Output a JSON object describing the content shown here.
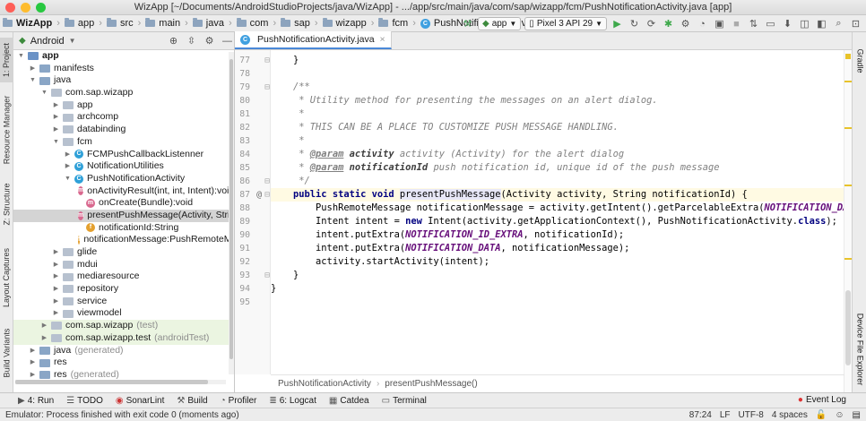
{
  "titlebar": {
    "title": "WizApp [~/Documents/AndroidStudioProjects/java/WizApp] - .../app/src/main/java/com/sap/wizapp/fcm/PushNotificationActivity.java [app]"
  },
  "navbar": {
    "crumbs": [
      "WizApp",
      "app",
      "src",
      "main",
      "java",
      "com",
      "sap",
      "wizapp",
      "fcm",
      "PushNotificationActivity"
    ],
    "run_config": "app",
    "device": "Pixel 3 API 29"
  },
  "left_strip": {
    "tabs": [
      "1: Project",
      "Resource Manager",
      "Z: Structure",
      "Layout Captures",
      "Build Variants"
    ]
  },
  "right_strip": {
    "tabs": [
      "Gradle",
      "Device File Explorer"
    ]
  },
  "project": {
    "view_label": "Android",
    "tree": [
      {
        "label": "app",
        "indent": 0,
        "icon": "module-folder-icon",
        "arrow": "down"
      },
      {
        "label": "manifests",
        "indent": 1,
        "icon": "folder-icon",
        "arrow": "right"
      },
      {
        "label": "java",
        "indent": 1,
        "icon": "folder-icon",
        "arrow": "down"
      },
      {
        "label": "com.sap.wizapp",
        "indent": 2,
        "icon": "package-icon",
        "arrow": "down"
      },
      {
        "label": "app",
        "indent": 3,
        "icon": "package-icon",
        "arrow": "right"
      },
      {
        "label": "archcomp",
        "indent": 3,
        "icon": "package-icon",
        "arrow": "right"
      },
      {
        "label": "databinding",
        "indent": 3,
        "icon": "package-icon",
        "arrow": "right"
      },
      {
        "label": "fcm",
        "indent": 3,
        "icon": "package-icon",
        "arrow": "down"
      },
      {
        "label": "FCMPushCallbackListenner",
        "indent": 4,
        "icon": "class",
        "arrow": "right"
      },
      {
        "label": "NotificationUtilities",
        "indent": 4,
        "icon": "class",
        "arrow": "right"
      },
      {
        "label": "PushNotificationActivity",
        "indent": 4,
        "icon": "class",
        "arrow": "down"
      },
      {
        "label": "onActivityResult(int, int, Intent):void",
        "indent": 5,
        "icon": "method",
        "arrow": ""
      },
      {
        "label": "onCreate(Bundle):void",
        "indent": 5,
        "icon": "method",
        "arrow": ""
      },
      {
        "label": "presentPushMessage(Activity, String):void",
        "indent": 5,
        "icon": "method",
        "arrow": "",
        "selected": true
      },
      {
        "label": "notificationId:String",
        "indent": 5,
        "icon": "field",
        "arrow": ""
      },
      {
        "label": "notificationMessage:PushRemoteMessage",
        "indent": 5,
        "icon": "field",
        "arrow": ""
      },
      {
        "label": "glide",
        "indent": 3,
        "icon": "package-icon",
        "arrow": "right"
      },
      {
        "label": "mdui",
        "indent": 3,
        "icon": "package-icon",
        "arrow": "right"
      },
      {
        "label": "mediaresource",
        "indent": 3,
        "icon": "package-icon",
        "arrow": "right"
      },
      {
        "label": "repository",
        "indent": 3,
        "icon": "package-icon",
        "arrow": "right"
      },
      {
        "label": "service",
        "indent": 3,
        "icon": "package-icon",
        "arrow": "right"
      },
      {
        "label": "viewmodel",
        "indent": 3,
        "icon": "package-icon",
        "arrow": "right"
      },
      {
        "label": "com.sap.wizapp",
        "suffix": "(test)",
        "indent": 2,
        "icon": "package-icon",
        "arrow": "right",
        "generated": true
      },
      {
        "label": "com.sap.wizapp.test",
        "suffix": "(androidTest)",
        "indent": 2,
        "icon": "package-icon",
        "arrow": "right",
        "generated": true
      },
      {
        "label": "java",
        "suffix": "(generated)",
        "indent": 1,
        "icon": "folder-icon",
        "arrow": "right"
      },
      {
        "label": "res",
        "indent": 1,
        "icon": "folder-icon",
        "arrow": "right"
      },
      {
        "label": "res",
        "suffix": "(generated)",
        "indent": 1,
        "icon": "folder-icon",
        "arrow": "right"
      }
    ]
  },
  "editor": {
    "file_tab": "PushNotificationActivity.java",
    "breadcrumb": [
      "PushNotificationActivity",
      "presentPushMessage()"
    ],
    "current_line": 87,
    "lines": [
      {
        "n": 77,
        "html": "    }"
      },
      {
        "n": 78,
        "html": ""
      },
      {
        "n": 79,
        "html": "    <span class='cm'>/**</span>"
      },
      {
        "n": 80,
        "html": "<span class='cm'>     * Utility method for presenting the messages on an alert dialog.</span>"
      },
      {
        "n": 81,
        "html": "<span class='cm'>     *</span>"
      },
      {
        "n": 82,
        "html": "<span class='cm'>     * THIS CAN BE A PLACE TO CUSTOMIZE PUSH MESSAGE HANDLING.</span>"
      },
      {
        "n": 83,
        "html": "<span class='cm'>     *</span>"
      },
      {
        "n": 84,
        "html": "<span class='cm'>     * </span><span class='tag'>@param</span><span class='cm'> </span><span class='pn'>activity</span><span class='cm'> activity (Activity) for the alert dialog</span>"
      },
      {
        "n": 85,
        "html": "<span class='cm'>     * </span><span class='tag'>@param</span><span class='cm'> </span><span class='pn'>notificationId</span><span class='cm'> push notification id, unique id of the push message</span>"
      },
      {
        "n": 86,
        "html": "<span class='cm'>     */</span>"
      },
      {
        "n": 87,
        "html": "    <span class='kw'>public static void</span> <span class='hl'>presentPushMessage</span>(Activity activity, String notificationId) {"
      },
      {
        "n": 88,
        "html": "        PushRemoteMessage notificationMessage = activity.getIntent().getParcelableExtra(<span class='cn'>NOTIFICATION_DATA</span>);"
      },
      {
        "n": 89,
        "html": "        Intent intent = <span class='kw'>new</span> Intent(activity.getApplicationContext(), PushNotificationActivity.<span class='kw'>class</span>);"
      },
      {
        "n": 90,
        "html": "        intent.putExtra(<span class='cn'>NOTIFICATION_ID_EXTRA</span>, notificationId);"
      },
      {
        "n": 91,
        "html": "        intent.putExtra(<span class='cn'>NOTIFICATION_DATA</span>, notificationMessage);"
      },
      {
        "n": 92,
        "html": "        activity.startActivity(intent);"
      },
      {
        "n": 93,
        "html": "    }"
      },
      {
        "n": 94,
        "html": "}"
      },
      {
        "n": 95,
        "html": ""
      }
    ]
  },
  "toolwindows": [
    {
      "icon": "play-icon",
      "label": "4: Run"
    },
    {
      "icon": "todo-icon",
      "label": "TODO"
    },
    {
      "icon": "sonarlint-icon",
      "label": "SonarLint"
    },
    {
      "icon": "hammer-icon",
      "label": "Build"
    },
    {
      "icon": "profiler-icon",
      "label": "Profiler"
    },
    {
      "icon": "logcat-icon",
      "label": "6: Logcat"
    },
    {
      "icon": "catdea-icon",
      "label": "Catdea"
    },
    {
      "icon": "terminal-icon",
      "label": "Terminal"
    }
  ],
  "event_log": "Event Log",
  "status": {
    "message": "Emulator: Process finished with exit code 0 (moments ago)",
    "position": "87:24",
    "line_sep": "LF",
    "encoding": "UTF-8",
    "indent": "4 spaces"
  },
  "colors": {
    "accent": "#4a88d8",
    "current_line": "#fffae3",
    "selection": "#d4d4d4",
    "generated_bg": "#ebf5e1"
  }
}
